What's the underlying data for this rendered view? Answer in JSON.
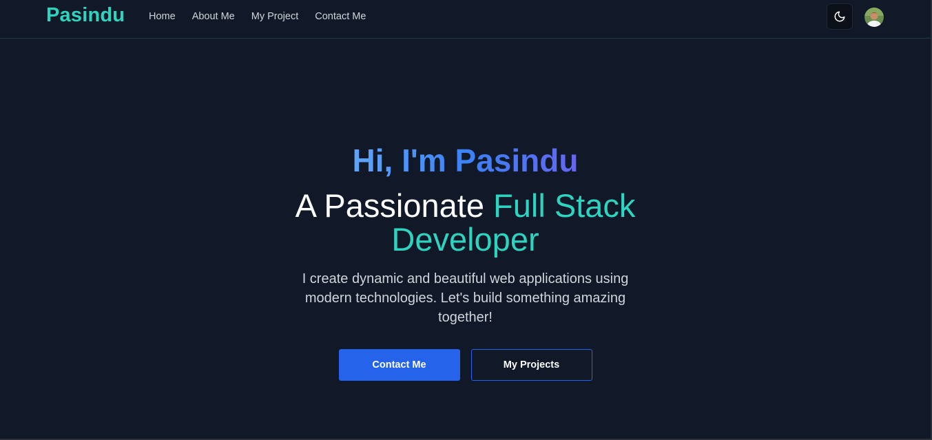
{
  "nav": {
    "brand": "Pasindu",
    "links": [
      "Home",
      "About Me",
      "My Project",
      "Contact Me"
    ],
    "theme_toggle_icon": "moon-icon",
    "avatar_icon": "profile-avatar"
  },
  "hero": {
    "greeting": "Hi, I'm Pasindu",
    "title_plain": "A Passionate ",
    "title_accent": "Full Stack Developer",
    "description": "I create dynamic and beautiful web applications using modern technologies. Let's build something amazing together!",
    "primary_button": "Contact Me",
    "secondary_button": "My Projects"
  },
  "colors": {
    "background": "#111827",
    "brand": "#2dd4bf",
    "accent_blue": "#2563eb",
    "gradient_start": "#60a5fa",
    "gradient_end": "#6366f1"
  }
}
